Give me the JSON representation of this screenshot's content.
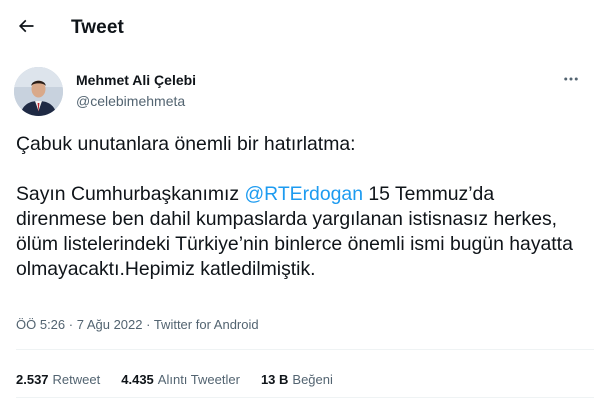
{
  "header": {
    "title": "Tweet"
  },
  "author": {
    "display_name": "Mehmet Ali Çelebi",
    "handle": "@celebimehmeta"
  },
  "tweet": {
    "line1": "Çabuk unutanlara önemli bir hatırlatma:",
    "para2_prefix": "Sayın Cumhurbaşkanımız ",
    "mention": "@RTErdogan",
    "para2_suffix": " 15 Temmuz’da direnmese ben dahil kumpaslarda yargılanan istisnasız herkes, ölüm listelerindeki Türkiye’nin binlerce önemli ismi bugün hayatta olmayacaktı.Hepimiz katledilmiştik."
  },
  "meta": {
    "time": "ÖÖ 5:26",
    "sep1": " · ",
    "date": "7 Ağu 2022",
    "sep2": " · ",
    "source": "Twitter for Android"
  },
  "stats": {
    "retweets_count": "2.537",
    "retweets_label": "Retweet",
    "quotes_count": "4.435",
    "quotes_label": "Alıntı Tweetler",
    "likes_count": "13 B",
    "likes_label": "Beğeni"
  },
  "icons": {
    "back": "arrow-left-icon",
    "more": "more-horizontal-icon"
  },
  "colors": {
    "text": "#0f1419",
    "secondary": "#536471",
    "link": "#1d9bf0",
    "divider": "#eff3f4"
  }
}
